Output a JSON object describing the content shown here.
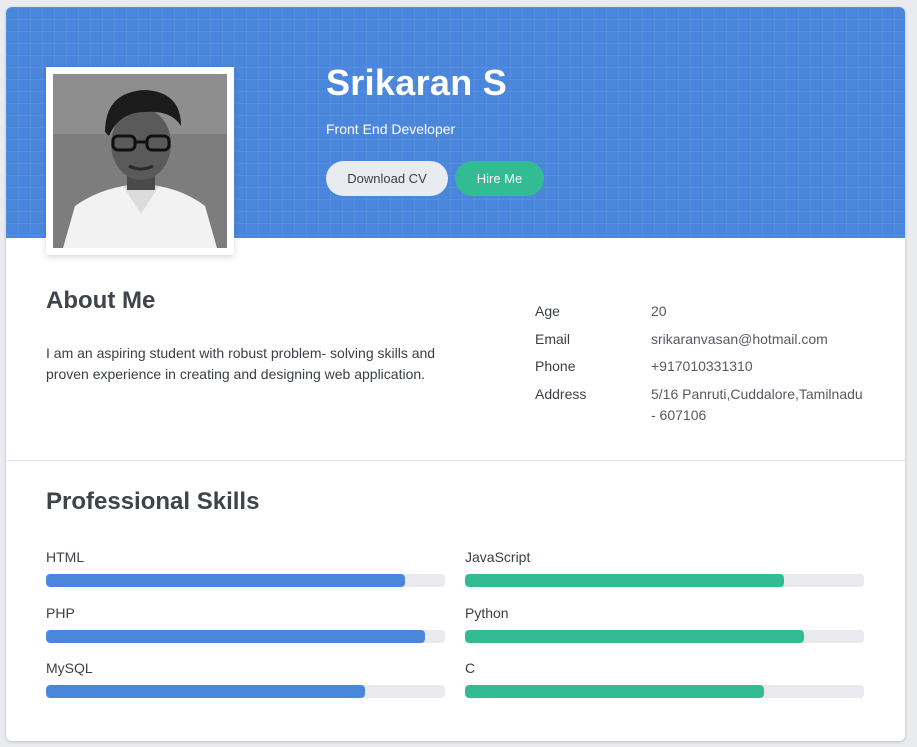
{
  "profile": {
    "name": "Srikaran S",
    "role": "Front End Developer",
    "download_cv_label": "Download CV",
    "hire_me_label": "Hire Me"
  },
  "about": {
    "title": "About Me",
    "text": "I am an aspiring student with robust problem- solving skills and proven experience in creating and designing web application.",
    "info": [
      {
        "key": "Age",
        "value": "20"
      },
      {
        "key": "Email",
        "value": "srikaranvasan@hotmail.com"
      },
      {
        "key": "Phone",
        "value": "+917010331310"
      },
      {
        "key": "Address",
        "value": "5/16 Panruti,Cuddalore,Tamilnadu - 607106"
      }
    ]
  },
  "skills": {
    "title": "Professional Skills",
    "left": [
      {
        "name": "HTML",
        "level": 0.9
      },
      {
        "name": "PHP",
        "level": 0.95
      },
      {
        "name": "MySQL",
        "level": 0.8
      }
    ],
    "right": [
      {
        "name": "JavaScript",
        "level": 0.8
      },
      {
        "name": "Python",
        "level": 0.85
      },
      {
        "name": "C",
        "level": 0.75
      }
    ]
  },
  "colors": {
    "header": "#4a86dc",
    "left_skill": "#4a86dc",
    "right_skill": "#33bb94",
    "hire_button": "#33bb94"
  }
}
